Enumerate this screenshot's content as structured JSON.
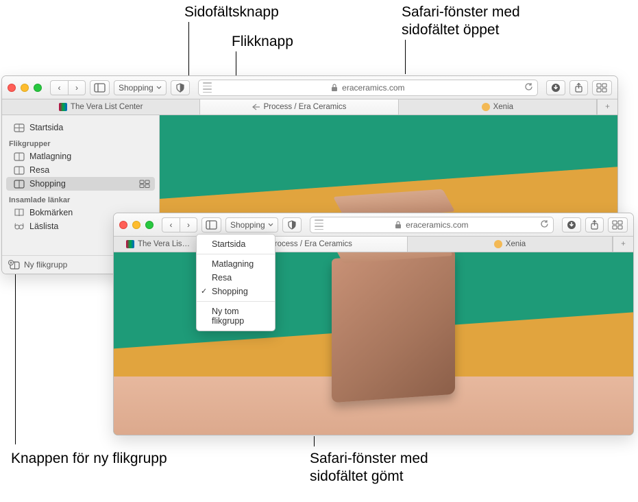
{
  "callouts": {
    "sidebar_button": "Sidofältsknapp",
    "tab_button": "Flikknapp",
    "window_sidebar_open": "Safari-fönster med sidofältet öppet",
    "new_tabgroup_button": "Knappen för ny flikgrupp",
    "window_sidebar_hidden": "Safari-fönster med sidofältet gömt"
  },
  "window1": {
    "tab_group_selected": "Shopping",
    "address": "eraceramics.com",
    "tabs": [
      {
        "title": "The Vera List Center"
      },
      {
        "title": "Process / Era Ceramics"
      },
      {
        "title": "Xenia"
      }
    ],
    "sidebar": {
      "start": "Startsida",
      "groups_header": "Flikgrupper",
      "groups": [
        "Matlagning",
        "Resa",
        "Shopping"
      ],
      "collected_header": "Insamlade länkar",
      "collected": [
        "Bokmärken",
        "Läslista"
      ],
      "footer": "Ny flikgrupp"
    }
  },
  "window2": {
    "tab_group_selected": "Shopping",
    "address": "eraceramics.com",
    "tabs": [
      {
        "title": "The Vera Lis…"
      },
      {
        "title": "Process / Era Ceramics"
      },
      {
        "title": "Xenia"
      }
    ],
    "dropdown": {
      "start": "Startsida",
      "groups": [
        "Matlagning",
        "Resa",
        "Shopping"
      ],
      "new": "Ny tom flikgrupp"
    }
  }
}
